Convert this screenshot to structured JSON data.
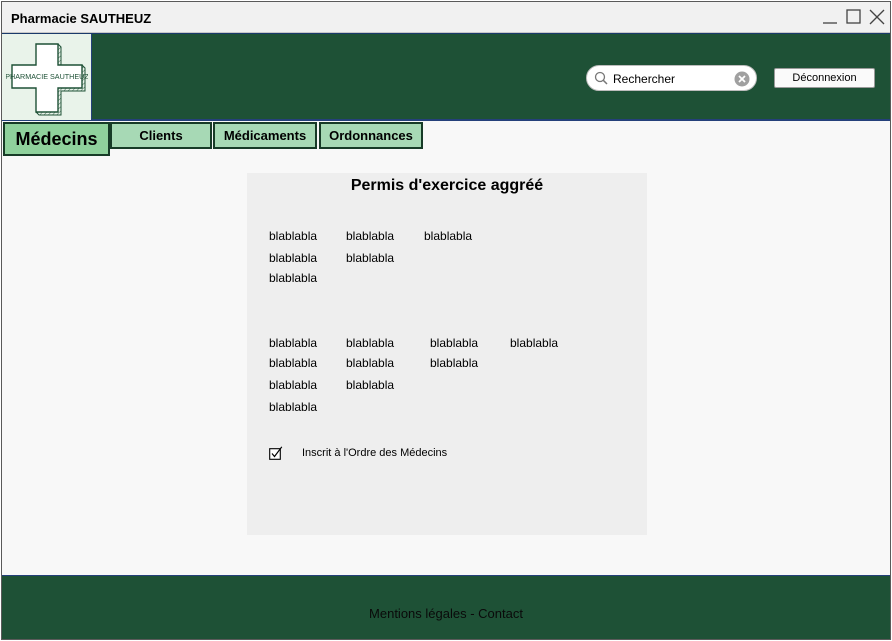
{
  "window": {
    "title": "Pharmacie SAUTHEUZ"
  },
  "header": {
    "logo_text": "PHARMACIE SAUTHEUZ",
    "search": {
      "value": "Rechercher",
      "placeholder": "Rechercher"
    },
    "logout_label": "Déconnexion"
  },
  "tabs": [
    {
      "label": "Médecins",
      "active": true
    },
    {
      "label": "Clients",
      "active": false
    },
    {
      "label": "Médicaments",
      "active": false
    },
    {
      "label": "Ordonnances",
      "active": false
    }
  ],
  "card": {
    "title": "Permis d'exercice aggréé",
    "group1": {
      "row1": [
        "blablabla",
        "blablabla",
        "blablabla"
      ],
      "row2": [
        "blablabla",
        "blablabla"
      ],
      "row3": [
        "blablabla"
      ]
    },
    "group2": {
      "row1": [
        "blablabla",
        "blablabla",
        "blablabla",
        "blablabla"
      ],
      "row2": [
        "blablabla",
        "blablabla",
        "blablabla"
      ],
      "row3": [
        "blablabla",
        "blablabla"
      ],
      "row4": [
        "blablabla"
      ]
    },
    "checkbox": {
      "label": "Inscrit à l'Ordre des Médecins",
      "checked": true
    }
  },
  "footer": {
    "text": "Mentions légales - Contact"
  },
  "colors": {
    "header_bg": "#1e5136",
    "tab_bg": "#a7d9b5",
    "active_tab_bg": "#8fd19c",
    "card_bg": "#eeeeee"
  }
}
